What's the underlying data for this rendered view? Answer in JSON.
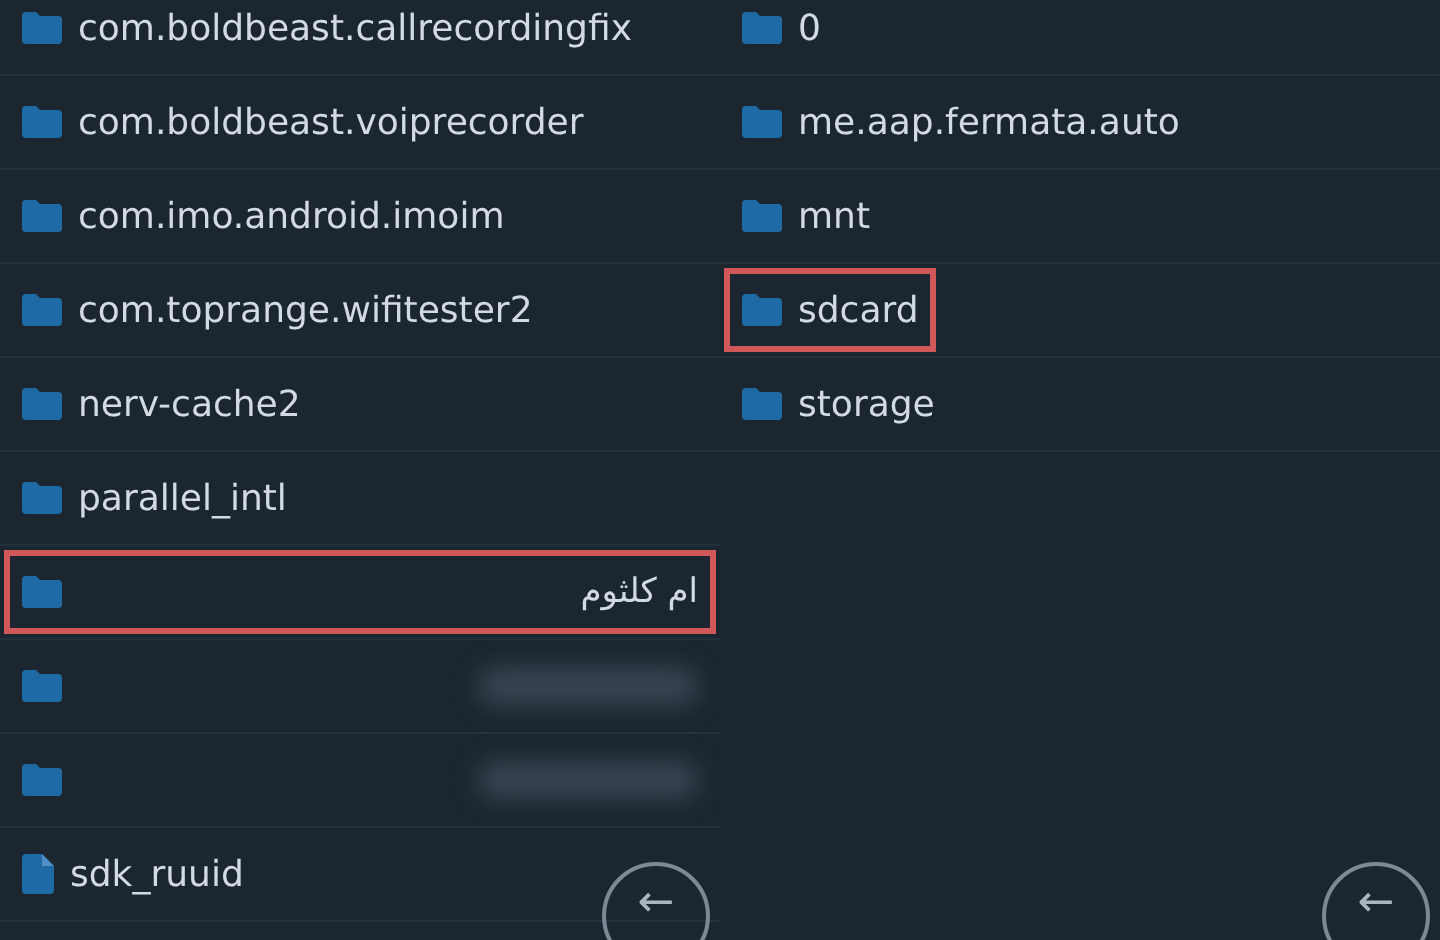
{
  "panes": [
    {
      "items": [
        {
          "kind": "folder",
          "name": "com.boldbeast.callrecordingfix",
          "rtl": false,
          "highlighted": false
        },
        {
          "kind": "folder",
          "name": "com.boldbeast.voiprecorder",
          "rtl": false,
          "highlighted": false
        },
        {
          "kind": "folder",
          "name": "com.imo.android.imoim",
          "rtl": false,
          "highlighted": false
        },
        {
          "kind": "folder",
          "name": "com.toprange.wifitester2",
          "rtl": false,
          "highlighted": false
        },
        {
          "kind": "folder",
          "name": "nerv-cache2",
          "rtl": false,
          "highlighted": false
        },
        {
          "kind": "folder",
          "name": "parallel_intl",
          "rtl": false,
          "highlighted": false
        },
        {
          "kind": "folder",
          "name": "ام كلثوم",
          "rtl": true,
          "highlighted": true
        },
        {
          "kind": "blurred-folder",
          "highlighted": false
        },
        {
          "kind": "blurred-folder",
          "highlighted": false
        },
        {
          "kind": "file",
          "name": "sdk_ruuid",
          "rtl": false,
          "highlighted": false
        }
      ],
      "back_button": {
        "icon": "←"
      }
    },
    {
      "items": [
        {
          "kind": "folder",
          "name": "0",
          "rtl": false,
          "highlighted": false
        },
        {
          "kind": "folder",
          "name": "me.aap.fermata.auto",
          "rtl": false,
          "highlighted": false
        },
        {
          "kind": "folder",
          "name": "mnt",
          "rtl": false,
          "highlighted": false
        },
        {
          "kind": "folder",
          "name": "sdcard",
          "rtl": false,
          "highlighted": true
        },
        {
          "kind": "folder",
          "name": "storage",
          "rtl": false,
          "highlighted": false
        }
      ],
      "back_button": {
        "icon": "←"
      }
    }
  ]
}
